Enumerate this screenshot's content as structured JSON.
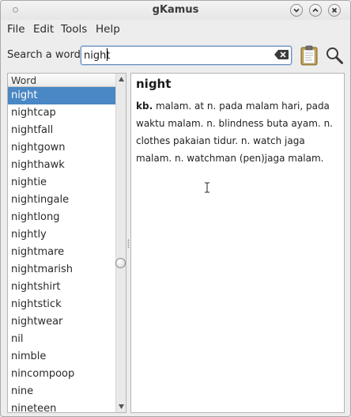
{
  "window": {
    "title": "gKamus"
  },
  "menu": {
    "items": [
      "File",
      "Edit",
      "Tools",
      "Help"
    ]
  },
  "search": {
    "label": "Search a word:",
    "value": "night"
  },
  "word_list": {
    "header": "Word",
    "selected_index": 0,
    "items": [
      "night",
      "nightcap",
      "nightfall",
      "nightgown",
      "nighthawk",
      "nightie",
      "nightingale",
      "nightlong",
      "nightly",
      "nightmare",
      "nightmarish",
      "nightshirt",
      "nightstick",
      "nightwear",
      "nil",
      "nimble",
      "nincompoop",
      "nine",
      "nineteen"
    ]
  },
  "definition": {
    "word": "night",
    "pos": "kb.",
    "text": "malam. at n. pada malam hari, pada waktu malam. n. blindness buta ayam. n. clothes pakaian tidur. n. watch jaga malam. n. watchman (pen)jaga malam."
  },
  "icons": {
    "minimize": "chevron-down-icon",
    "maximize": "chevron-up-icon",
    "close": "close-icon",
    "clear": "clear-text-icon",
    "paste": "clipboard-icon",
    "search": "magnifier-icon"
  },
  "colors": {
    "selection": "#4a87c5",
    "focus_border": "#6e8fb7"
  }
}
